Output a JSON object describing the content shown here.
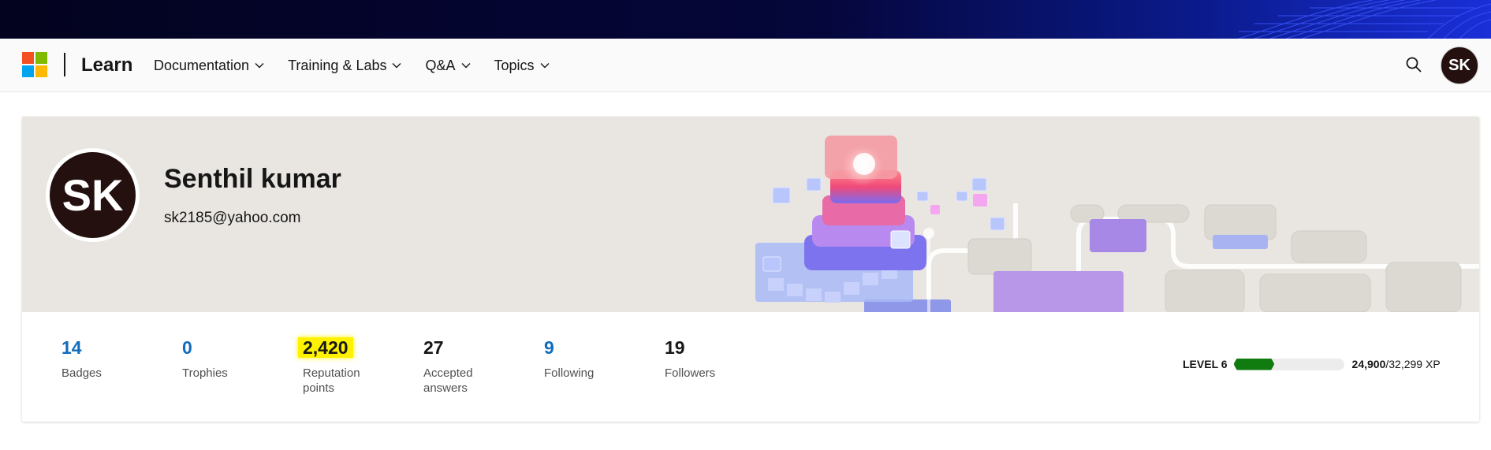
{
  "header": {
    "brand": "Learn",
    "nav": [
      {
        "label": "Documentation"
      },
      {
        "label": "Training & Labs"
      },
      {
        "label": "Q&A"
      },
      {
        "label": "Topics"
      }
    ],
    "search_icon": "search-icon",
    "avatar_initials": "SK"
  },
  "profile": {
    "initials": "SK",
    "name": "Senthil kumar",
    "email": "sk2185@yahoo.com"
  },
  "stats": [
    {
      "value": "14",
      "label": "Badges"
    },
    {
      "value": "0",
      "label": "Trophies"
    },
    {
      "value": "2,420",
      "label": "Reputation points"
    },
    {
      "value": "27",
      "label": "Accepted answers"
    },
    {
      "value": "9",
      "label": "Following"
    },
    {
      "value": "19",
      "label": "Followers"
    }
  ],
  "level": {
    "label": "LEVEL 6",
    "xp_current": "24,900",
    "xp_total": "/32,299 XP",
    "progress_fraction": 0.37
  },
  "colors": {
    "accent_link": "#0f6cbd",
    "progress": "#107c10",
    "highlight": "#fff200",
    "avatar_bg": "#24100e"
  }
}
